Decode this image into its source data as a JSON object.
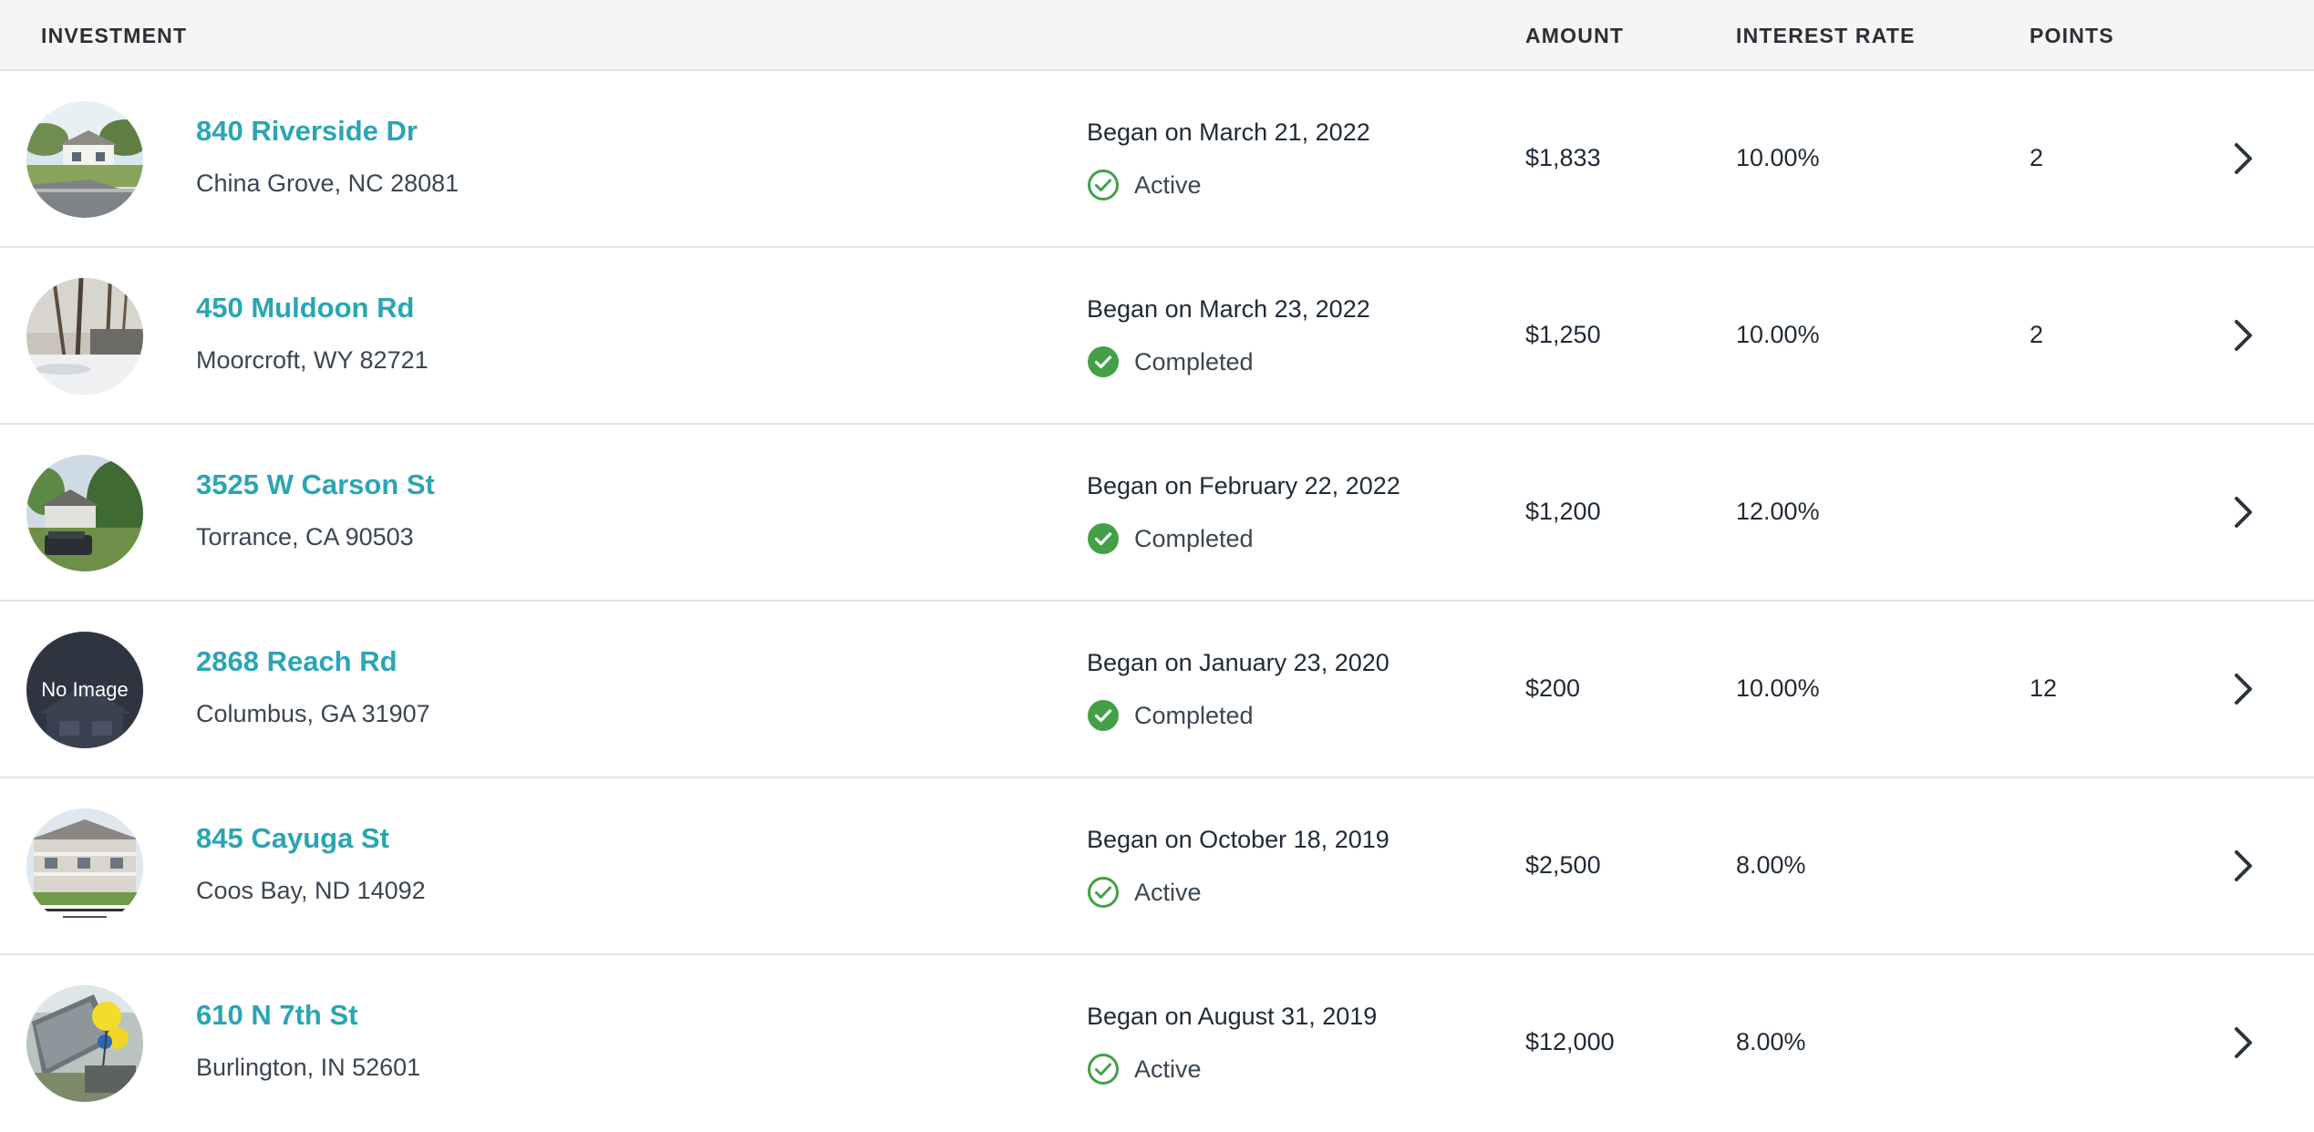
{
  "table": {
    "headers": {
      "investment": "INVESTMENT",
      "amount": "AMOUNT",
      "interest_rate": "INTEREST RATE",
      "points": "POINTS"
    },
    "rows": [
      {
        "address": "840 Riverside Dr",
        "city": "China Grove, NC 28081",
        "began": "Began on March 21, 2022",
        "status": "Active",
        "amount": "$1,833",
        "interest_rate": "10.00%",
        "points": "2",
        "thumb_label": ""
      },
      {
        "address": "450 Muldoon Rd",
        "city": "Moorcroft, WY 82721",
        "began": "Began on March 23, 2022",
        "status": "Completed",
        "amount": "$1,250",
        "interest_rate": "10.00%",
        "points": "2",
        "thumb_label": ""
      },
      {
        "address": "3525 W Carson St",
        "city": "Torrance, CA 90503",
        "began": "Began on February 22, 2022",
        "status": "Completed",
        "amount": "$1,200",
        "interest_rate": "12.00%",
        "points": "",
        "thumb_label": ""
      },
      {
        "address": "2868 Reach Rd",
        "city": "Columbus, GA 31907",
        "began": "Began on January 23, 2020",
        "status": "Completed",
        "amount": "$200",
        "interest_rate": "10.00%",
        "points": "12",
        "thumb_label": "No Image"
      },
      {
        "address": "845 Cayuga St",
        "city": "Coos Bay, ND 14092",
        "began": "Began on October 18, 2019",
        "status": "Active",
        "amount": "$2,500",
        "interest_rate": "8.00%",
        "points": "",
        "thumb_label": ""
      },
      {
        "address": "610 N 7th St",
        "city": "Burlington, IN 52601",
        "began": "Began on August 31, 2019",
        "status": "Active",
        "amount": "$12,000",
        "interest_rate": "8.00%",
        "points": "",
        "thumb_label": ""
      }
    ]
  },
  "icons": {
    "status_active": "check-circle-outline-icon",
    "status_completed": "check-circle-filled-icon",
    "row_action": "chevron-right-icon"
  },
  "colors": {
    "link": "#2aa5b4",
    "status_green": "#43a047",
    "header_bg": "#f5f5f5",
    "divider": "#e3e3e3"
  }
}
